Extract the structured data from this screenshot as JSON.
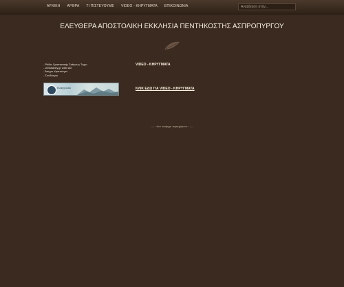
{
  "nav": {
    "items": [
      "ΑΡΧΙΚΗ",
      "ΑΡΘΡΑ",
      "ΤΙ ΠΙΣΤΕΥΟΥΜΕ",
      "VIDEO - ΚΗΡΥΓΜΑΤΑ",
      "ΕΠΙΚΟΙΝΩΝΙΑ"
    ],
    "search_placeholder": "Αναζήτηση στην..."
  },
  "header": {
    "title": "ΕΛΕΥΘΕΡΑ ΑΠΟΣΤΟΛΙΚΗ ΕΚΚΛΗΣΙΑ ΠΕΝΤΗΚΟΣΤΗΣ ΑΣΠΡΟΠΥΡΓΟΥ"
  },
  "sidebar": {
    "links": [
      "- Ράδιο Χριστιανικής Σκέψεως Τυχιο",
      "- christianity.gr web site",
      "- Άσημο Χριστούγεν",
      "- Συνδέσμοι"
    ],
    "banner_text": "Ευαγγελικό"
  },
  "main": {
    "heading": "VIDEO - ΚΗΡΥΓΜΑΤΑ",
    "link": "ΚΛΙΚ ΕΔΩ ΓΙΑ VIDEO - ΚΗΡΥΓΜΑΤΑ"
  },
  "footer": {
    "divider_text": "— ◦ Δεν υπάρχει περιεχόμενο ◦ —"
  }
}
